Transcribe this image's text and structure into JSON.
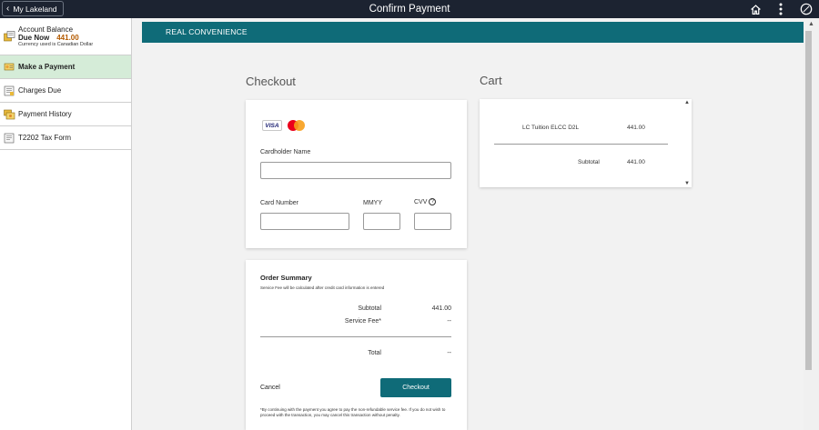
{
  "header": {
    "back_label": "My Lakeland",
    "title": "Confirm Payment",
    "icons": [
      "home-icon",
      "more-icon",
      "navbar-icon"
    ]
  },
  "sidebar": {
    "account": {
      "title": "Account Balance",
      "due_label": "Due Now",
      "due_amount": "441.00",
      "currency_note": "Currency used is Canadian Dollar"
    },
    "items": [
      {
        "label": "Make a Payment",
        "icon": "payment-icon",
        "active": true
      },
      {
        "label": "Charges Due",
        "icon": "charges-icon",
        "active": false
      },
      {
        "label": "Payment History",
        "icon": "history-icon",
        "active": false
      },
      {
        "label": "T2202 Tax Form",
        "icon": "tax-form-icon",
        "active": false
      }
    ]
  },
  "banner": {
    "text": "REAL CONVENIENCE"
  },
  "checkout": {
    "title": "Checkout",
    "card_logos": {
      "visa": "VISA",
      "mastercard": "mastercard"
    },
    "cardholder_label": "Cardholder Name",
    "cardholder_value": "",
    "card_number_label": "Card Number",
    "card_number_value": "",
    "mmyy_label": "MMYY",
    "mmyy_value": "",
    "cvv_label": "CVV",
    "cvv_help": "?",
    "cvv_value": ""
  },
  "order_summary": {
    "title": "Order Summary",
    "note": "Service Fee will be calculated after credit card information is entered",
    "subtotal_label": "Subtotal",
    "subtotal_value": "441.00",
    "service_fee_label": "Service Fee*",
    "service_fee_value": "--",
    "total_label": "Total",
    "total_value": "--",
    "cancel_label": "Cancel",
    "checkout_label": "Checkout",
    "disclaimer": "*By continuing with the payment you agree to pay the non-refundable service fee. If you do not wish to proceed with the transaction, you may cancel this transaction without penalty."
  },
  "cart": {
    "title": "Cart",
    "item_name": "LC Tuition ELCC D2L",
    "item_amount": "441.00",
    "subtotal_label": "Subtotal",
    "subtotal_value": "441.00"
  },
  "colors": {
    "topbar": "#1c2331",
    "brand_teal": "#0f6b78",
    "active_nav": "#d5ecd8",
    "due_amount": "#b35a00"
  }
}
